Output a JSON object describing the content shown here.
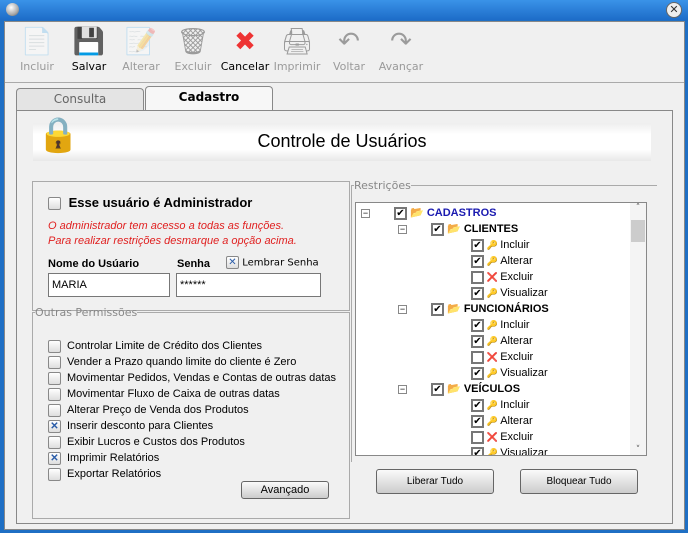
{
  "window": {
    "close_icon": "close-icon"
  },
  "toolbar": [
    {
      "label": "Incluir",
      "icon": "📄",
      "enabled": false
    },
    {
      "label": "Salvar",
      "icon": "💾",
      "enabled": true
    },
    {
      "label": "Alterar",
      "icon": "📝",
      "enabled": false
    },
    {
      "label": "Excluir",
      "icon": "🗑",
      "enabled": false
    },
    {
      "label": "Cancelar",
      "icon": "✖",
      "enabled": true
    },
    {
      "label": "Imprimir",
      "icon": "🖨",
      "enabled": false
    },
    {
      "label": "Voltar",
      "icon": "↶",
      "enabled": false
    },
    {
      "label": "Avançar",
      "icon": "↷",
      "enabled": false
    }
  ],
  "tabs": {
    "consulta": "Consulta",
    "cadastro": "Cadastro"
  },
  "header": {
    "title": "Controle de Usuários"
  },
  "admin": {
    "label": "Esse usuário é Administrador",
    "checked": false,
    "note1": "O administrador tem acesso a todas as funções.",
    "note2": "Para realizar restrições desmarque a opção acima."
  },
  "form": {
    "user_label": "Nome do Usúario",
    "user_value": "MARIA",
    "pass_label": "Senha",
    "pass_value": "******",
    "remember_label": "Lembrar Senha",
    "remember_checked": true
  },
  "permissions": {
    "legend": "Outras Permissões",
    "items": [
      {
        "label": "Controlar Limite de Crédito dos Clientes",
        "checked": false
      },
      {
        "label": "Vender a Prazo quando limite do cliente é Zero",
        "checked": false
      },
      {
        "label": "Movimentar Pedidos, Vendas e Contas de outras datas",
        "checked": false
      },
      {
        "label": "Movimentar Fluxo de Caixa de outras datas",
        "checked": false
      },
      {
        "label": "Alterar Preço de Venda dos Produtos",
        "checked": false
      },
      {
        "label": "Inserir desconto para Clientes",
        "checked": true
      },
      {
        "label": "Exibir Lucros e Custos dos Produtos",
        "checked": false
      },
      {
        "label": "Imprimir Relatórios",
        "checked": true
      },
      {
        "label": "Exportar Relatórios",
        "checked": false
      }
    ],
    "advanced": "Avançado"
  },
  "restrictions": {
    "legend": "Restrições",
    "root": "CADASTROS",
    "groups": [
      {
        "name": "CLIENTES",
        "items": [
          {
            "label": "Incluir",
            "checked": true
          },
          {
            "label": "Alterar",
            "checked": true
          },
          {
            "label": "Excluir",
            "checked": false
          },
          {
            "label": "Visualizar",
            "checked": true
          }
        ]
      },
      {
        "name": "FUNCIONÁRIOS",
        "items": [
          {
            "label": "Incluir",
            "checked": true
          },
          {
            "label": "Alterar",
            "checked": true
          },
          {
            "label": "Excluir",
            "checked": false
          },
          {
            "label": "Visualizar",
            "checked": true
          }
        ]
      },
      {
        "name": "VEÍCULOS",
        "items": [
          {
            "label": "Incluir",
            "checked": true
          },
          {
            "label": "Alterar",
            "checked": true
          },
          {
            "label": "Excluir",
            "checked": false
          },
          {
            "label": "Visualizar",
            "checked": true
          }
        ]
      }
    ],
    "release_all": "Liberar Tudo",
    "block_all": "Bloquear Tudo"
  }
}
